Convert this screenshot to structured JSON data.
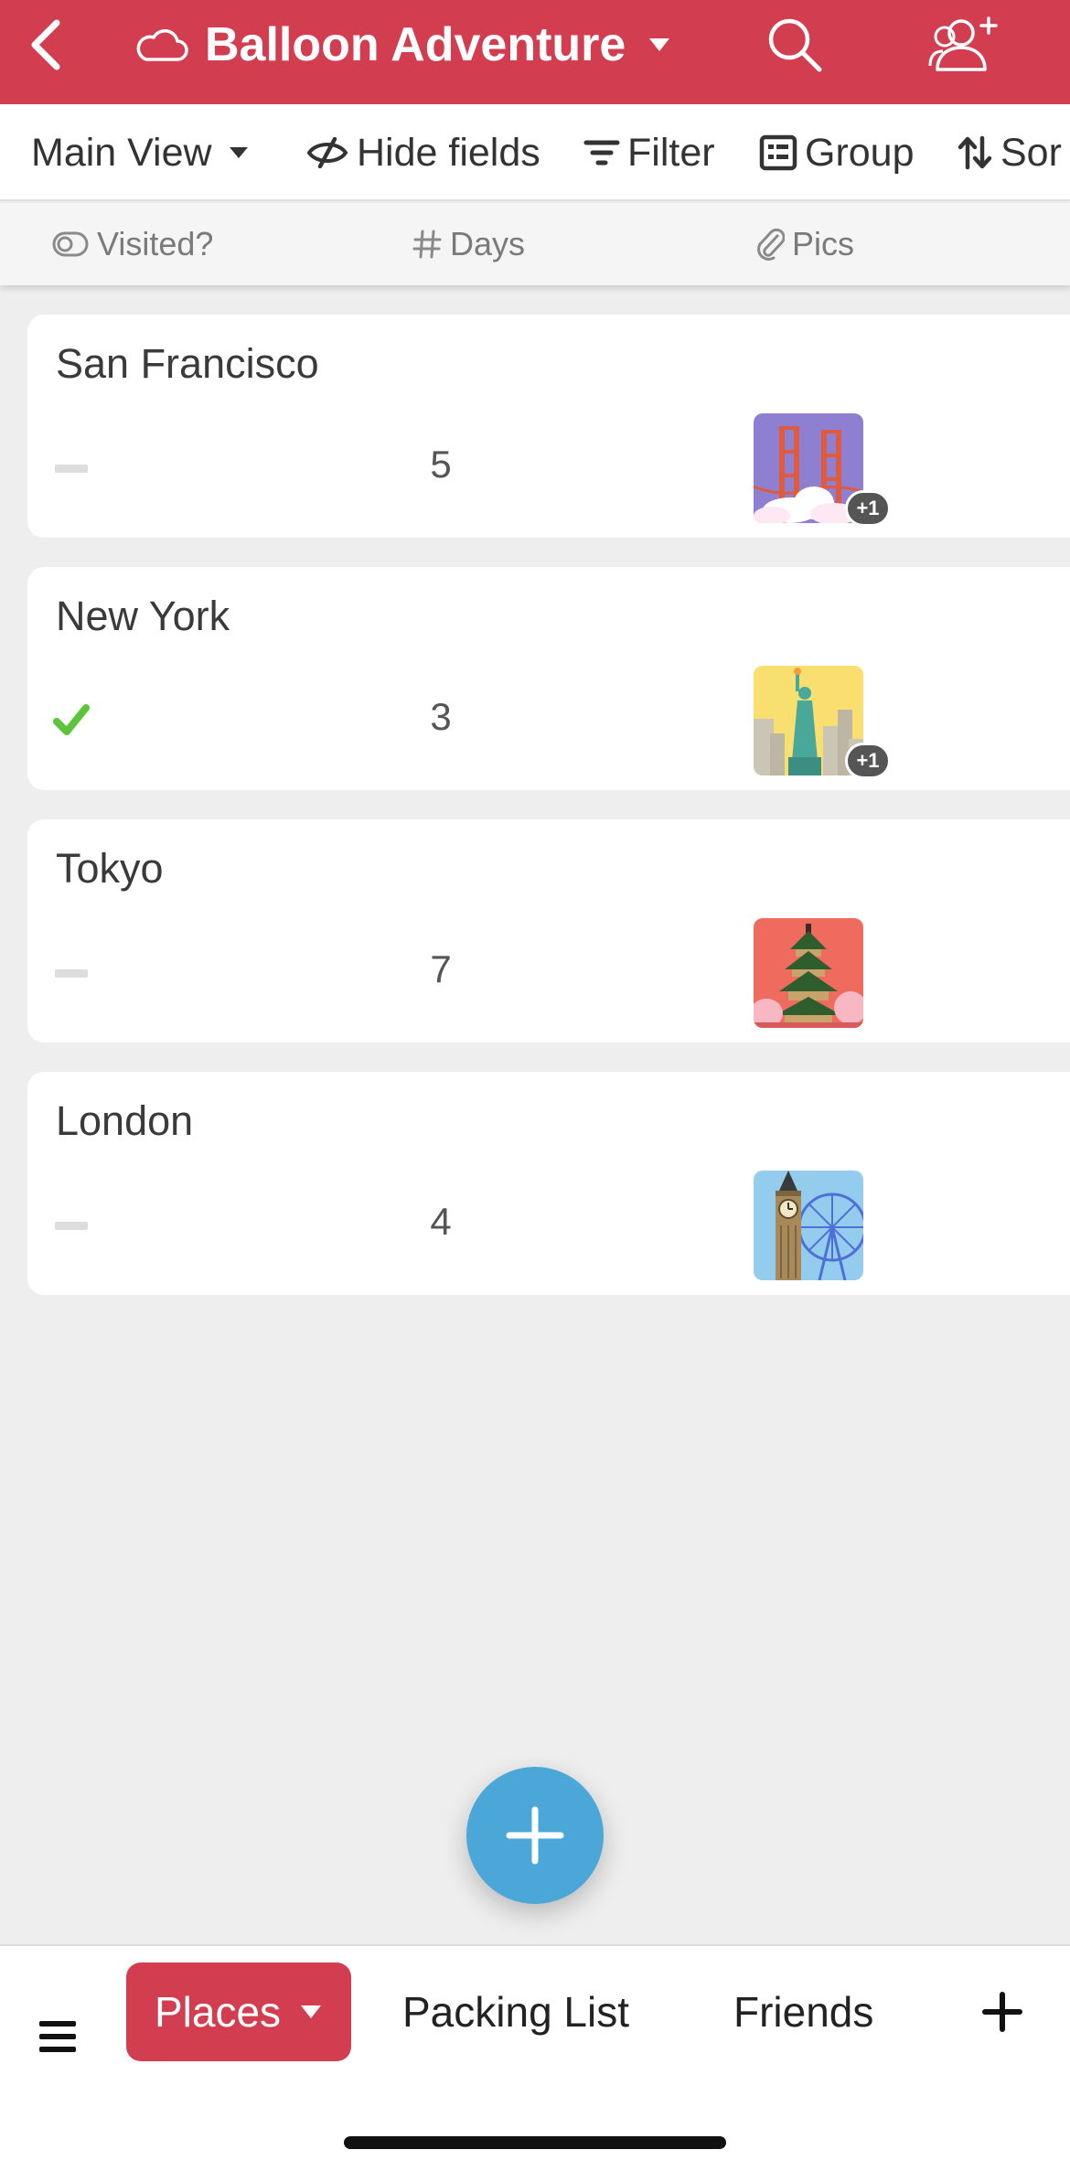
{
  "header": {
    "title": "Balloon Adventure",
    "back_icon": "chevron-left-icon",
    "base_icon": "cloud-icon",
    "search_icon": "search-icon",
    "share_icon": "add-collaborator-icon",
    "background": "#d33d50"
  },
  "toolbar": {
    "view_label": "Main View",
    "hide_fields_label": "Hide fields",
    "filter_label": "Filter",
    "group_label": "Group",
    "sort_label": "Sor"
  },
  "columns": [
    {
      "label": "Visited?",
      "icon": "checkbox-icon"
    },
    {
      "label": "Days",
      "icon": "hash-icon"
    },
    {
      "label": "Pics",
      "icon": "paperclip-icon"
    }
  ],
  "records": [
    {
      "name": "San Francisco",
      "visited": false,
      "days": "5",
      "pic": "golden-gate-bridge",
      "extra_pics": "+1"
    },
    {
      "name": "New York",
      "visited": true,
      "days": "3",
      "pic": "statue-of-liberty",
      "extra_pics": "+1"
    },
    {
      "name": "Tokyo",
      "visited": false,
      "days": "7",
      "pic": "pagoda",
      "extra_pics": ""
    },
    {
      "name": "London",
      "visited": false,
      "days": "4",
      "pic": "big-ben",
      "extra_pics": ""
    }
  ],
  "fab": {
    "icon": "plus-icon",
    "color": "#4aa7d8"
  },
  "bottom_tabs": {
    "menu_icon": "hamburger-menu-icon",
    "active": "Places",
    "tabs": [
      "Packing List",
      "Friends"
    ],
    "add_icon": "plus-icon"
  },
  "colors": {
    "accent": "#d33d50",
    "check": "#5cc43a"
  }
}
